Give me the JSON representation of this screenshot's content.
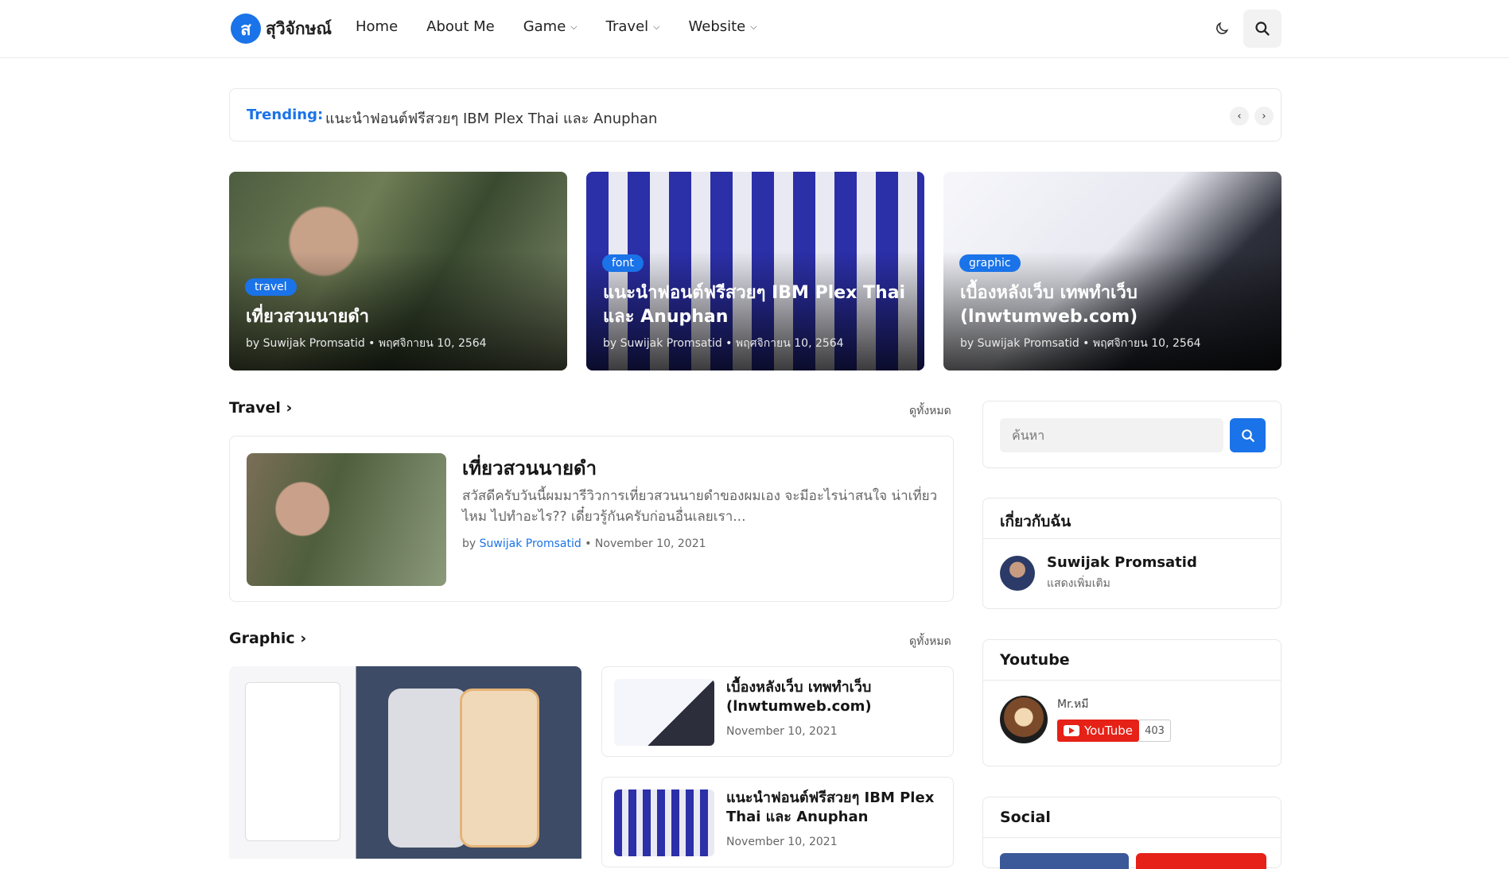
{
  "header": {
    "logo_letter": "ส",
    "logo_text": "สุวิจักษณ์",
    "nav": [
      {
        "label": "Home",
        "dropdown": false
      },
      {
        "label": "About Me",
        "dropdown": false
      },
      {
        "label": "Game",
        "dropdown": true
      },
      {
        "label": "Travel",
        "dropdown": true
      },
      {
        "label": "Website",
        "dropdown": true
      }
    ]
  },
  "trending": {
    "label": "Trending:",
    "text": "แนะนำฟอนต์ฟรีสวยๆ IBM Plex Thai และ Anuphan"
  },
  "featured": [
    {
      "tag": "travel",
      "title": "เที่ยวสวนนายดำ",
      "meta": "by Suwijak Promsatid • พฤศจิกายน 10, 2564"
    },
    {
      "tag": "font",
      "title": "แนะนำฟอนต์ฟรีสวยๆ IBM Plex Thai และ Anuphan",
      "meta": "by Suwijak Promsatid • พฤศจิกายน 10, 2564"
    },
    {
      "tag": "graphic",
      "title": "เบื้องหลังเว็บ เทพทำเว็บ (lnwtumweb.com)",
      "meta": "by Suwijak Promsatid • พฤศจิกายน 10, 2564"
    }
  ],
  "travel_section": {
    "title": "Travel",
    "more": "ดูทั้งหมด",
    "post": {
      "title": "เที่ยวสวนนายดำ",
      "snippet": "สวัสดีครับวันนี้ผมมารีวิวการเที่ยวสวนนายดำของผมเอง จะมีอะไรน่าสนใจ น่าเที่ยวไหม ไปทำอะไร?? เดี๋ยวรู้กันครับก่อนอื่นเลยเรา...",
      "by": "by",
      "author": "Suwijak Promsatid",
      "date": "• November 10, 2021"
    }
  },
  "graphic_section": {
    "title": "Graphic",
    "more": "ดูทั้งหมด",
    "posts": [
      {
        "title": "เบื้องหลังเว็บ เทพทำเว็บ (lnwtumweb.com)",
        "date": "November 10, 2021"
      },
      {
        "title": "แนะนำฟอนต์ฟรีสวยๆ IBM Plex Thai และ Anuphan",
        "date": "November 10, 2021"
      }
    ]
  },
  "sidebar": {
    "search_placeholder": "ค้นหา",
    "about": {
      "title": "เกี่ยวกับฉัน",
      "name": "Suwijak Promsatid",
      "more": "แสดงเพิ่มเติม"
    },
    "youtube": {
      "title": "Youtube",
      "channel": "Mr.หมี",
      "button": "YouTube",
      "count": "403"
    },
    "social": {
      "title": "Social"
    }
  },
  "colors": {
    "accent": "#1a73e8",
    "youtube": "#e62117"
  }
}
